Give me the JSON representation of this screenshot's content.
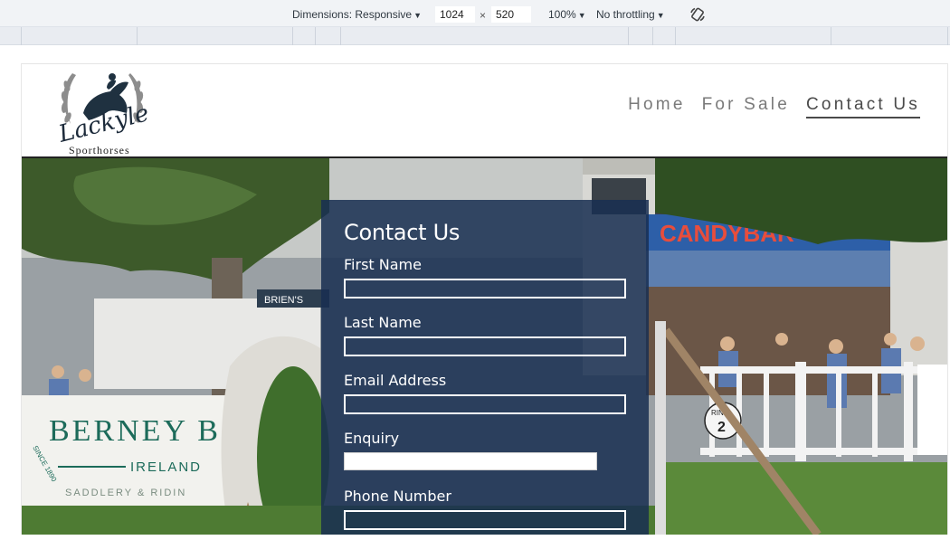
{
  "devtools": {
    "dimensions_label": "Dimensions: Responsive",
    "width_value": "1024",
    "height_value": "520",
    "times_sign": "×",
    "zoom": "100%",
    "throttling": "No throttling",
    "caret": "▼"
  },
  "site": {
    "logo": {
      "script_text": "Lackyle",
      "subtitle": "Sporthorses"
    },
    "nav": [
      {
        "label": "Home",
        "active": false
      },
      {
        "label": "For Sale",
        "active": false
      },
      {
        "label": "Contact Us",
        "active": true
      }
    ]
  },
  "hero": {
    "signage": {
      "berney_line1": "BERNEY B",
      "berney_line2": "IRELAND",
      "berney_line3": "SADDLERY & RIDIN",
      "berney_since": "SINCE 1890",
      "shop_sign": "CANDYBAR",
      "brien_sign": "BRIEN'S",
      "ring_label": "RING",
      "ring_number": "2"
    }
  },
  "form": {
    "title": "Contact Us",
    "fields": [
      {
        "label": "First Name",
        "value": ""
      },
      {
        "label": "Last Name",
        "value": ""
      },
      {
        "label": "Email Address",
        "value": ""
      },
      {
        "label": "Enquiry",
        "value": ""
      },
      {
        "label": "Phone Number",
        "value": ""
      }
    ]
  },
  "colors": {
    "panel_bg": "#192e52",
    "nav_text": "#7a7a7a",
    "devtools_bg": "#f1f3f6"
  }
}
